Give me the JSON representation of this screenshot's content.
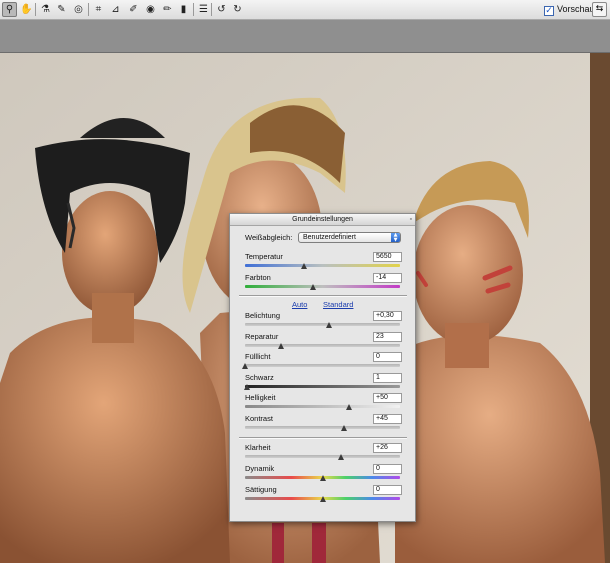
{
  "toolbar": {
    "tools": [
      {
        "name": "zoom-tool",
        "glyph": "⚲",
        "active": true
      },
      {
        "name": "hand-tool",
        "glyph": "✋",
        "active": false
      },
      {
        "name": "white-balance-tool",
        "glyph": "⚗",
        "active": false
      },
      {
        "name": "color-sampler-tool",
        "glyph": "✎",
        "active": false
      },
      {
        "name": "targeted-adjustment-tool",
        "glyph": "◎",
        "active": false
      },
      {
        "name": "crop-tool",
        "glyph": "⌗",
        "active": false
      },
      {
        "name": "straighten-tool",
        "glyph": "⊿",
        "active": false
      },
      {
        "name": "spot-removal-tool",
        "glyph": "✐",
        "active": false
      },
      {
        "name": "red-eye-tool",
        "glyph": "◉",
        "active": false
      },
      {
        "name": "adjustment-brush-tool",
        "glyph": "✏",
        "active": false
      },
      {
        "name": "graduated-filter-tool",
        "glyph": "▮",
        "active": false
      },
      {
        "name": "preferences-tool",
        "glyph": "☰",
        "active": false
      },
      {
        "name": "rotate-left-tool",
        "glyph": "↺",
        "active": false
      },
      {
        "name": "rotate-right-tool",
        "glyph": "↻",
        "active": false
      }
    ],
    "preview_label": "Vorschau",
    "preview_checked": true,
    "fullscreen_glyph": "⇆"
  },
  "panel": {
    "title": "Grundeinstellungen",
    "close_glyph": "▫",
    "white_balance_label": "Weißabgleich:",
    "white_balance_value": "Benutzerdefiniert",
    "auto_label": "Auto",
    "standard_label": "Standard",
    "sliders": [
      {
        "key": "temp",
        "label": "Temperatur",
        "value": "5650",
        "position": 0.38,
        "track": "temp"
      },
      {
        "key": "tint",
        "label": "Farbton",
        "value": "-14",
        "position": 0.44,
        "track": "tint"
      },
      {
        "key": "exposure",
        "label": "Belichtung",
        "value": "+0,30",
        "position": 0.54,
        "track": "plain"
      },
      {
        "key": "recovery",
        "label": "Reparatur",
        "value": "23",
        "position": 0.23,
        "track": "plain"
      },
      {
        "key": "fill",
        "label": "Fülllicht",
        "value": "0",
        "position": 0.0,
        "track": "plain"
      },
      {
        "key": "blacks",
        "label": "Schwarz",
        "value": "1",
        "position": 0.01,
        "track": "dark"
      },
      {
        "key": "brightness",
        "label": "Helligkeit",
        "value": "+50",
        "position": 0.67,
        "track": "light"
      },
      {
        "key": "contrast",
        "label": "Kontrast",
        "value": "+45",
        "position": 0.64,
        "track": "plain"
      },
      {
        "key": "clarity",
        "label": "Klarheit",
        "value": "+26",
        "position": 0.62,
        "track": "plain"
      },
      {
        "key": "vibrance",
        "label": "Dynamik",
        "value": "0",
        "position": 0.5,
        "track": "vib"
      },
      {
        "key": "saturation",
        "label": "Sättigung",
        "value": "0",
        "position": 0.5,
        "track": "vib"
      }
    ]
  },
  "colors": {
    "toolbar_bg": "#e6e6e6",
    "panel_bg": "#e6e6e6",
    "link": "#1a3cad",
    "skin": "#c98a5c",
    "wall": "#d9d3c9"
  }
}
